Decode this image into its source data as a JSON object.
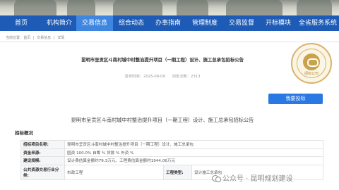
{
  "nav": {
    "items": [
      {
        "label": "首页",
        "active": false
      },
      {
        "label": "机构简介",
        "active": false
      },
      {
        "label": "交易信息",
        "active": true
      },
      {
        "label": "综合动态",
        "active": false
      },
      {
        "label": "办事指南",
        "active": false
      },
      {
        "label": "管理制度",
        "active": false
      },
      {
        "label": "交易监督",
        "active": false
      },
      {
        "label": "开标模块",
        "active": false
      },
      {
        "label": "全省服务系统",
        "active": false
      }
    ]
  },
  "breadcrumb": {
    "prefix": "当前位置:",
    "items": [
      "首页",
      "交易信息",
      "详情"
    ],
    "separator": "|"
  },
  "article": {
    "title": "昆明市呈贡区斗南村城中村整治提升项目（一期工程）设计、施工总承包招标公告",
    "published_label": "发布时间：2025-09-09",
    "views_label": "浏览次数：2313",
    "bid_button_label": "我要投标",
    "subtitle": "昆明市呈贡区斗南村城中村整治提升项目（一期工程）设计、施工总承包招标公告",
    "section_label": "招标概况"
  },
  "seal": {
    "mark_text": "招标公司",
    "accent_color": "#d9b26a"
  },
  "table": {
    "rows": [
      {
        "key": "招标项目名称:",
        "value": "昆明市呈贡区斗南村城中村整治提升项目（一期工程）设计、施工总承包"
      },
      {
        "key": "资金来源:",
        "value": "国资 100.0% 自筹 % 贷款 % 外资 %"
      },
      {
        "key": "建设规模:",
        "value": "设计费估算金额约79.3万元、工程费估算金额约1944.06万元"
      },
      {
        "key": "公共资源交易行业分类:",
        "value": "市政工程",
        "key2": "工程类型:",
        "value2": "设计施工总承包"
      }
    ]
  },
  "watermark": {
    "text": "公众号 · 昆明规划建设"
  },
  "colors": {
    "nav_bg": "#1d5bb6",
    "nav_active": "#3f86e0",
    "button": "#2a78e4"
  }
}
